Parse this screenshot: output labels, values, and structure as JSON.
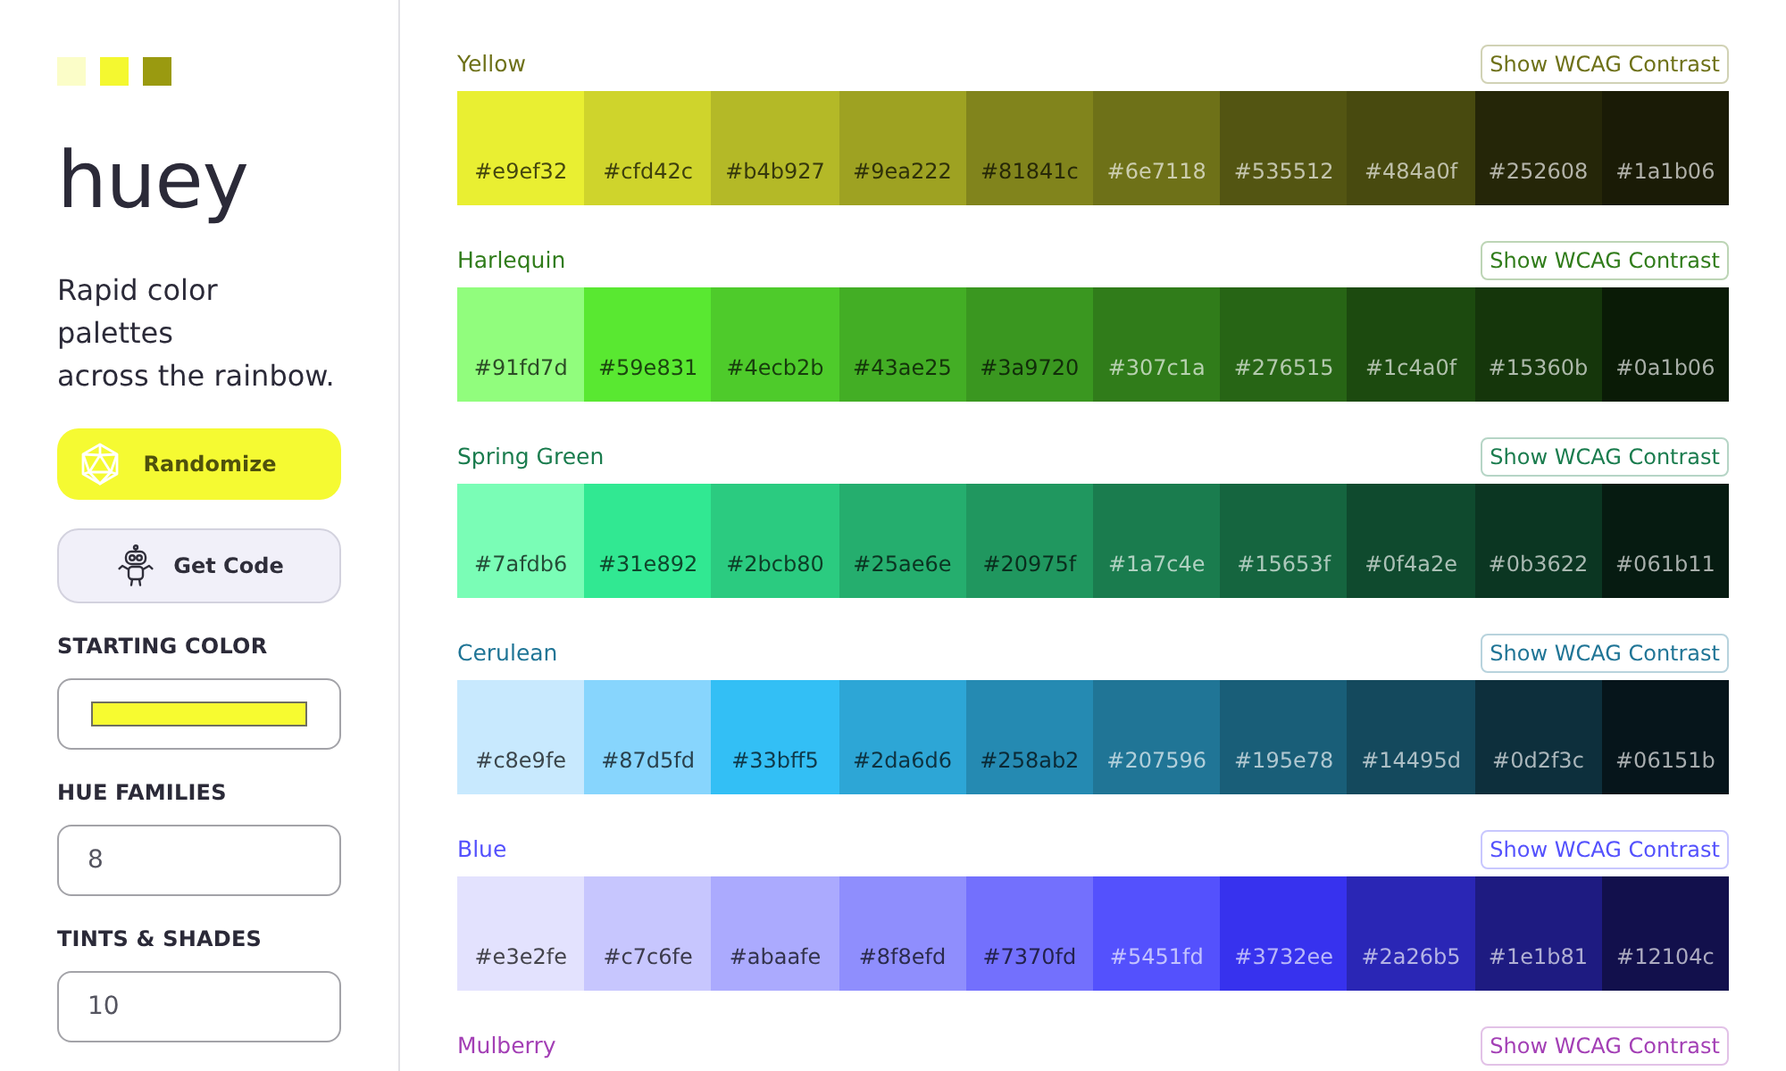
{
  "sidebar": {
    "logo": {
      "swatches": [
        {
          "color": "#fbfdc8"
        },
        {
          "color": "#f4f830"
        },
        {
          "color": "#9a9a10"
        }
      ],
      "wordmark": "huey"
    },
    "tagline": "Rapid color palettes\nacross the rainbow.",
    "buttons": [
      {
        "kind": "primary",
        "label": "Randomize"
      },
      {
        "kind": "secondary",
        "label": "Get Code"
      }
    ],
    "fields": [
      {
        "kind": "color",
        "label": "STARTING COLOR",
        "color": "#f7fb30"
      },
      {
        "kind": "number",
        "label": "HUE FAMILIES",
        "value": "8"
      },
      {
        "kind": "number",
        "label": "TINTS & SHADES",
        "value": "10"
      }
    ]
  },
  "families": [
    {
      "name": "Yellow",
      "color": "#6e7118",
      "button": "Show WCAG Contrast",
      "swatches": [
        {
          "label": "#e9ef32",
          "color": "#e9ef32"
        },
        {
          "label": "#cfd42c",
          "color": "#cfd42c"
        },
        {
          "label": "#b4b927",
          "color": "#b4b927"
        },
        {
          "label": "#9ea222",
          "color": "#9ea222"
        },
        {
          "label": "#81841c",
          "color": "#81841c"
        },
        {
          "label": "#6e7118",
          "color": "#6e7118"
        },
        {
          "label": "#535512",
          "color": "#535512"
        },
        {
          "label": "#484a0f",
          "color": "#484a0f"
        },
        {
          "label": "#252608",
          "color": "#252608"
        },
        {
          "label": "#1a1b06",
          "color": "#1a1b06"
        }
      ]
    },
    {
      "name": "Harlequin",
      "color": "#307c1a",
      "button": "Show WCAG Contrast",
      "swatches": [
        {
          "label": "#91fd7d",
          "color": "#91fd7d"
        },
        {
          "label": "#59e831",
          "color": "#59e831"
        },
        {
          "label": "#4ecb2b",
          "color": "#4ecb2b"
        },
        {
          "label": "#43ae25",
          "color": "#43ae25"
        },
        {
          "label": "#3a9720",
          "color": "#3a9720"
        },
        {
          "label": "#307c1a",
          "color": "#307c1a"
        },
        {
          "label": "#276515",
          "color": "#276515"
        },
        {
          "label": "#1c4a0f",
          "color": "#1c4a0f"
        },
        {
          "label": "#15360b",
          "color": "#15360b"
        },
        {
          "label": "#0a1b06",
          "color": "#0a1b06"
        }
      ]
    },
    {
      "name": "Spring Green",
      "color": "#1a7c4e",
      "button": "Show WCAG Contrast",
      "swatches": [
        {
          "label": "#7afdb6",
          "color": "#7afdb6"
        },
        {
          "label": "#31e892",
          "color": "#31e892"
        },
        {
          "label": "#2bcb80",
          "color": "#2bcb80"
        },
        {
          "label": "#25ae6e",
          "color": "#25ae6e"
        },
        {
          "label": "#20975f",
          "color": "#20975f"
        },
        {
          "label": "#1a7c4e",
          "color": "#1a7c4e"
        },
        {
          "label": "#15653f",
          "color": "#15653f"
        },
        {
          "label": "#0f4a2e",
          "color": "#0f4a2e"
        },
        {
          "label": "#0b3622",
          "color": "#0b3622"
        },
        {
          "label": "#061b11",
          "color": "#061b11"
        }
      ]
    },
    {
      "name": "Cerulean",
      "color": "#207596",
      "button": "Show WCAG Contrast",
      "swatches": [
        {
          "label": "#c8e9fe",
          "color": "#c8e9fe"
        },
        {
          "label": "#87d5fd",
          "color": "#87d5fd"
        },
        {
          "label": "#33bff5",
          "color": "#33bff5"
        },
        {
          "label": "#2da6d6",
          "color": "#2da6d6"
        },
        {
          "label": "#258ab2",
          "color": "#258ab2"
        },
        {
          "label": "#207596",
          "color": "#207596"
        },
        {
          "label": "#195e78",
          "color": "#195e78"
        },
        {
          "label": "#14495d",
          "color": "#14495d"
        },
        {
          "label": "#0d2f3c",
          "color": "#0d2f3c"
        },
        {
          "label": "#06151b",
          "color": "#06151b"
        }
      ]
    },
    {
      "name": "Blue",
      "color": "#5451fd",
      "button": "Show WCAG Contrast",
      "swatches": [
        {
          "label": "#e3e2fe",
          "color": "#e3e2fe"
        },
        {
          "label": "#c7c6fe",
          "color": "#c7c6fe"
        },
        {
          "label": "#abaafe",
          "color": "#abaafe"
        },
        {
          "label": "#8f8efd",
          "color": "#8f8efd"
        },
        {
          "label": "#7370fd",
          "color": "#7370fd"
        },
        {
          "label": "#5451fd",
          "color": "#5451fd"
        },
        {
          "label": "#3732ee",
          "color": "#3732ee"
        },
        {
          "label": "#2a26b5",
          "color": "#2a26b5"
        },
        {
          "label": "#1e1b81",
          "color": "#1e1b81"
        },
        {
          "label": "#12104c",
          "color": "#12104c"
        }
      ]
    },
    {
      "name": "Mulberry",
      "color": "#a33fb5",
      "button": "Show WCAG Contrast"
    }
  ]
}
